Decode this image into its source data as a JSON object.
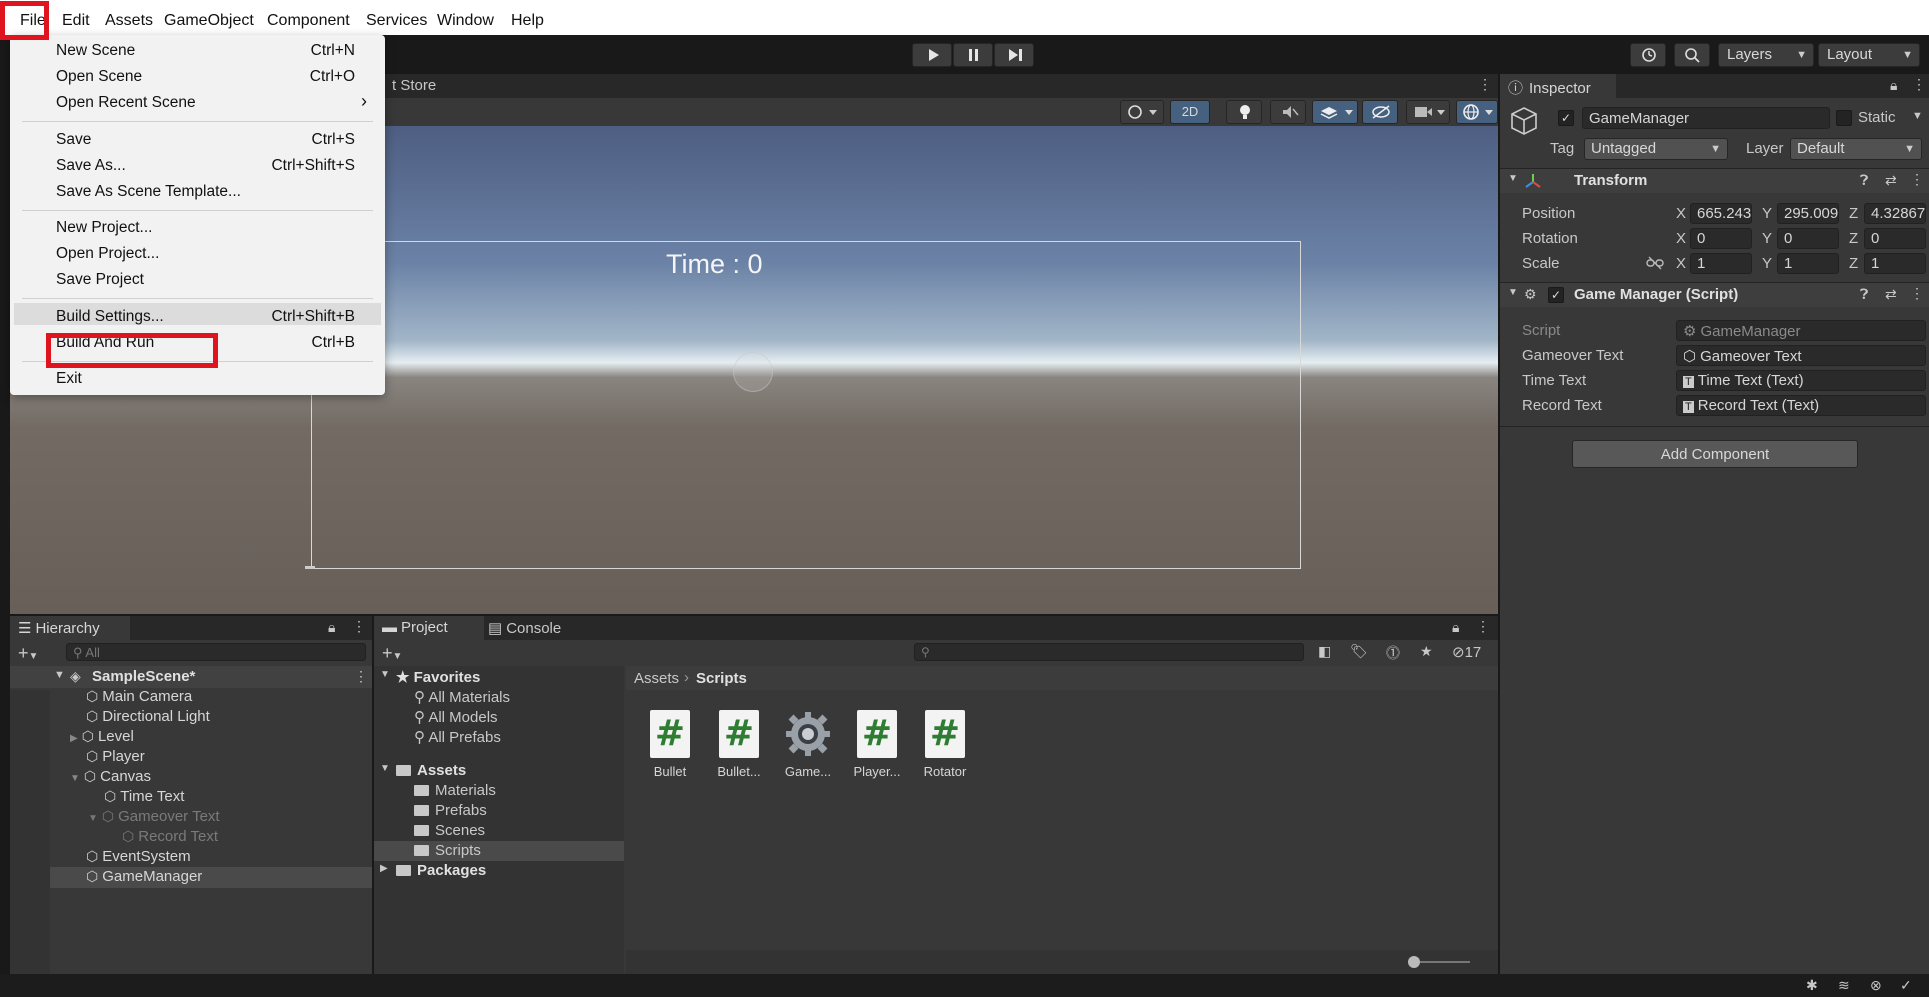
{
  "menubar": {
    "items": [
      "File",
      "Edit",
      "Assets",
      "GameObject",
      "Component",
      "Services",
      "Window",
      "Help"
    ]
  },
  "toolbar": {
    "layers_label": "Layers",
    "layout_label": "Layout"
  },
  "scene": {
    "tab_partial": "t Store",
    "btn_2d": "2D",
    "game_text": "Time : 0"
  },
  "file_menu": {
    "items": [
      {
        "label": "New Scene",
        "shortcut": "Ctrl+N"
      },
      {
        "label": "Open Scene",
        "shortcut": "Ctrl+O"
      },
      {
        "label": "Open Recent Scene",
        "shortcut": "›"
      },
      {
        "label": "Save",
        "shortcut": "Ctrl+S"
      },
      {
        "label": "Save As...",
        "shortcut": "Ctrl+Shift+S"
      },
      {
        "label": "Save As Scene Template...",
        "shortcut": ""
      },
      {
        "label": "New Project...",
        "shortcut": ""
      },
      {
        "label": "Open Project...",
        "shortcut": ""
      },
      {
        "label": "Save Project",
        "shortcut": ""
      },
      {
        "label": "Build Settings...",
        "shortcut": "Ctrl+Shift+B"
      },
      {
        "label": "Build And Run",
        "shortcut": "Ctrl+B"
      },
      {
        "label": "Exit",
        "shortcut": ""
      }
    ]
  },
  "inspector": {
    "tab": "Inspector",
    "object_name": "GameManager",
    "static_label": "Static",
    "tag_label": "Tag",
    "tag_value": "Untagged",
    "layer_label": "Layer",
    "layer_value": "Default",
    "transform": {
      "title": "Transform",
      "position_label": "Position",
      "rotation_label": "Rotation",
      "scale_label": "Scale",
      "position": {
        "x": "665.243",
        "y": "295.009",
        "z": "4.32867"
      },
      "rotation": {
        "x": "0",
        "y": "0",
        "z": "0"
      },
      "scale": {
        "x": "1",
        "y": "1",
        "z": "1"
      },
      "axis_x": "X",
      "axis_y": "Y",
      "axis_z": "Z"
    },
    "script_component": {
      "title": "Game Manager (Script)",
      "fields": [
        {
          "label": "Script",
          "value": "GameManager"
        },
        {
          "label": "Gameover Text",
          "value": "Gameover Text"
        },
        {
          "label": "Time Text",
          "value": "Time Text (Text)"
        },
        {
          "label": "Record Text",
          "value": "Record Text (Text)"
        }
      ]
    },
    "add_component": "Add Component"
  },
  "hierarchy": {
    "tab": "Hierarchy",
    "search_placeholder": "All",
    "scene_name": "SampleScene*",
    "items": [
      "Main Camera",
      "Directional Light",
      "Level",
      "Player",
      "Canvas",
      "Time Text",
      "Gameover Text",
      "Record Text",
      "EventSystem",
      "GameManager"
    ]
  },
  "project": {
    "tab_project": "Project",
    "tab_console": "Console",
    "hidden_count": "17",
    "favorites_label": "Favorites",
    "favorites": [
      "All Materials",
      "All Models",
      "All Prefabs"
    ],
    "assets_label": "Assets",
    "folders": [
      "Materials",
      "Prefabs",
      "Scenes",
      "Scripts"
    ],
    "packages_label": "Packages",
    "breadcrumb": [
      "Assets",
      "Scripts"
    ],
    "assets": [
      "Bullet",
      "Bullet...",
      "Game...",
      "Player...",
      "Rotator"
    ]
  }
}
